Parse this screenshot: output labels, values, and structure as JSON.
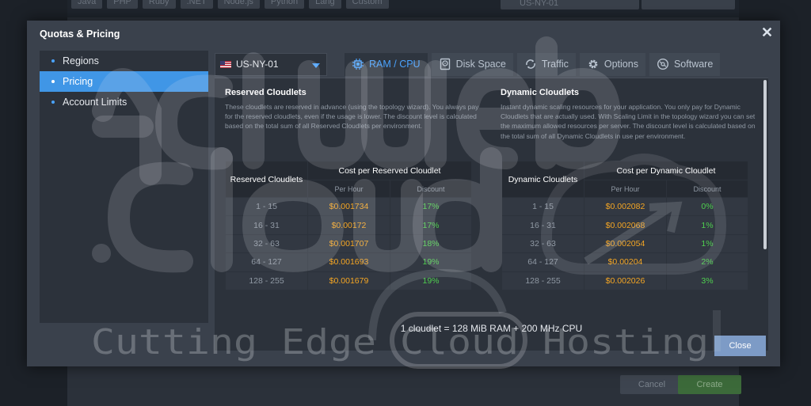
{
  "background": {
    "tabs": [
      "Java",
      "PHP",
      "Ruby",
      ".NET",
      "Node.js",
      "Python",
      "Lang",
      "Custom"
    ],
    "region": "US-NY-01",
    "cancel_label": "Cancel",
    "create_label": "Create"
  },
  "modal": {
    "title": "Quotas & Pricing",
    "close_label": "Close"
  },
  "sidebar": {
    "items": [
      {
        "label": "Regions"
      },
      {
        "label": "Pricing"
      },
      {
        "label": "Account Limits"
      }
    ],
    "active": "Pricing"
  },
  "toolbar": {
    "region": "US-NY-01",
    "tabs": [
      {
        "label": "RAM / CPU",
        "icon": "cpu-icon"
      },
      {
        "label": "Disk Space",
        "icon": "disk-icon"
      },
      {
        "label": "Traffic",
        "icon": "traffic-icon"
      },
      {
        "label": "Options",
        "icon": "gear-icon"
      },
      {
        "label": "Software",
        "icon": "software-icon"
      }
    ],
    "active_tab": "RAM / CPU"
  },
  "reserved": {
    "title": "Reserved Cloudlets",
    "description": "These cloudlets are reserved in advance (using the topology wizard). You always pay for the reserved cloudlets, even if the usage is lower. The discount level is calculated based on the total sum of all Reserved Cloudlets per environment.",
    "header_left": "Reserved Cloudlets",
    "header_group": "Cost per Reserved Cloudlet",
    "col_per_hour": "Per Hour",
    "col_discount": "Discount",
    "rows": [
      {
        "range": "1 - 15",
        "cost": "$0.001734",
        "discount": "17%"
      },
      {
        "range": "16 - 31",
        "cost": "$0.00172",
        "discount": "17%"
      },
      {
        "range": "32 - 63",
        "cost": "$0.001707",
        "discount": "18%"
      },
      {
        "range": "64 - 127",
        "cost": "$0.001693",
        "discount": "19%"
      },
      {
        "range": "128 - 255",
        "cost": "$0.001679",
        "discount": "19%"
      }
    ]
  },
  "dynamic": {
    "title": "Dynamic Cloudlets",
    "description": "Instant dynamic scaling resources for your application. You only pay for Dynamic Cloudlets that are actually used. With Scaling Limit in the topology wizard you can set the maximum allowed resources per server. The discount level is calculated based on the total sum of all Dynamic Cloudlets in use per environment.",
    "header_left": "Dynamic Cloudlets",
    "header_group": "Cost per Dynamic Cloudlet",
    "col_per_hour": "Per Hour",
    "col_discount": "Discount",
    "rows": [
      {
        "range": "1 - 15",
        "cost": "$0.002082",
        "discount": "0%"
      },
      {
        "range": "16 - 31",
        "cost": "$0.002068",
        "discount": "1%"
      },
      {
        "range": "32 - 63",
        "cost": "$0.002054",
        "discount": "1%"
      },
      {
        "range": "64 - 127",
        "cost": "$0.00204",
        "discount": "2%"
      },
      {
        "range": "128 - 255",
        "cost": "$0.002026",
        "discount": "3%"
      }
    ]
  },
  "footnote": "1 cloudlet = 128 MiB RAM + 200 MHz CPU",
  "watermark": {
    "text": "Cutting Edge Cloud Hosting"
  },
  "colors": {
    "accent": "#4096e6",
    "cost": "#f5a623",
    "discount": "#4fcf4f"
  }
}
